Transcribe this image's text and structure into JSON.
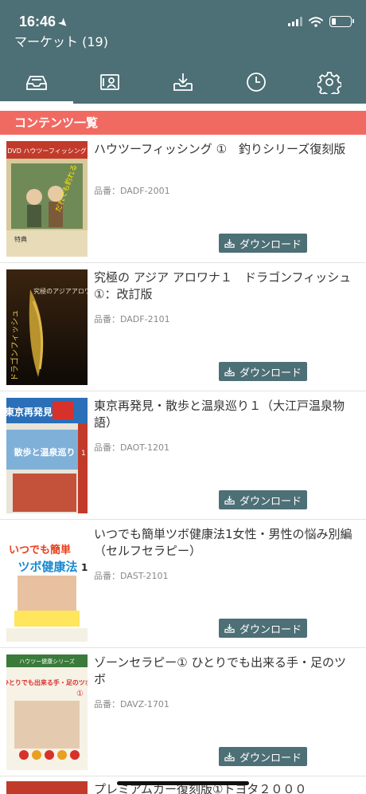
{
  "status": {
    "time": "16:46",
    "battery_level": 0.22
  },
  "header": {
    "title": "マーケット (19)"
  },
  "tabs": [
    {
      "name": "tab-market",
      "icon": "inbox-tray-icon",
      "active": true
    },
    {
      "name": "tab-library",
      "icon": "portrait-card-icon",
      "active": false
    },
    {
      "name": "tab-downloads",
      "icon": "download-tray-icon",
      "active": false
    },
    {
      "name": "tab-history",
      "icon": "clock-icon",
      "active": false
    },
    {
      "name": "tab-settings",
      "icon": "gear-icon",
      "active": false
    }
  ],
  "section": {
    "title": "コンテンツ一覧"
  },
  "colors": {
    "primary": "#4d6f76",
    "accent": "#f16a62"
  },
  "items": [
    {
      "title": "ハウツーフィッシング ①　釣りシリーズ復刻版",
      "code": "品番：DADF-2001",
      "button": "ダウンロード",
      "cover": {
        "top": "DVD ハウツーフィッシング",
        "main": "だれでも釣れる",
        "sub": "特典"
      }
    },
    {
      "title": "究極の アジア アロワナ１　ドラゴンフィッシュ①：改訂版",
      "code": "品番：DADF-2101",
      "button": "ダウンロード",
      "cover": {
        "top": "究極のアジアアロワナ",
        "main": "ドラゴンフィッシュ",
        "sub": ""
      }
    },
    {
      "title": "東京再発見・散歩と温泉巡り１（大江戸温泉物語）",
      "code": "品番：DAOT-1201",
      "button": "ダウンロード",
      "cover": {
        "top": "東京再発見",
        "main": "散歩と温泉巡り",
        "sub": "1"
      }
    },
    {
      "title": "いつでも簡単ツボ健康法1女性・男性の悩み別編（セルフセラピー）",
      "code": "品番：DAST-2101",
      "button": "ダウンロード",
      "cover": {
        "top": "いつでも簡単",
        "main": "ツボ健康法",
        "sub": "1"
      }
    },
    {
      "title": "ゾーンセラピー① ひとりでも出来る手・足のツボ",
      "code": "品番：DAVZ-1701",
      "button": "ダウンロード",
      "cover": {
        "top": "ハウツー健康シリーズ",
        "main": "ひとりでも出来る手・足のツボ",
        "sub": "①"
      }
    }
  ],
  "partial_item": {
    "title": "プレミアムカー復刻版①トヨタ２０００"
  }
}
